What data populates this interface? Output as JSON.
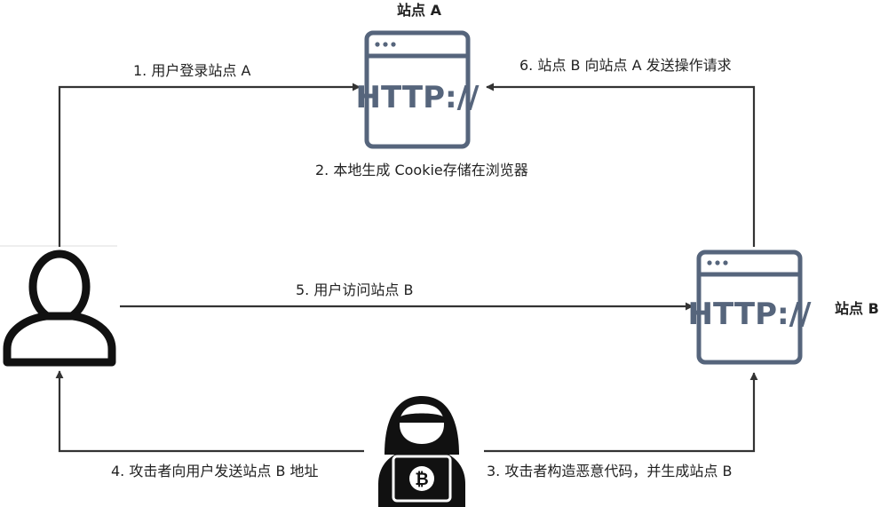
{
  "site_a_title": "站点 A",
  "site_b_title": "站点 B",
  "http_text": "HTTP://",
  "bitcoin_symbol": "₿",
  "steps": {
    "s1": "1. 用户登录站点 A",
    "s2": "2. 本地生成 Cookie存储在浏览器",
    "s3": "3. 攻击者构造恶意代码，并生成站点 B",
    "s4": "4. 攻击者向用户发送站点 B 地址",
    "s5": "5. 用户访问站点 B",
    "s6": "6. 站点 B 向站点 A 发送操作请求"
  },
  "colors": {
    "browser_outline": "#56657c",
    "arrow": "#333333",
    "person": "#111111",
    "hacker": "#111111"
  }
}
